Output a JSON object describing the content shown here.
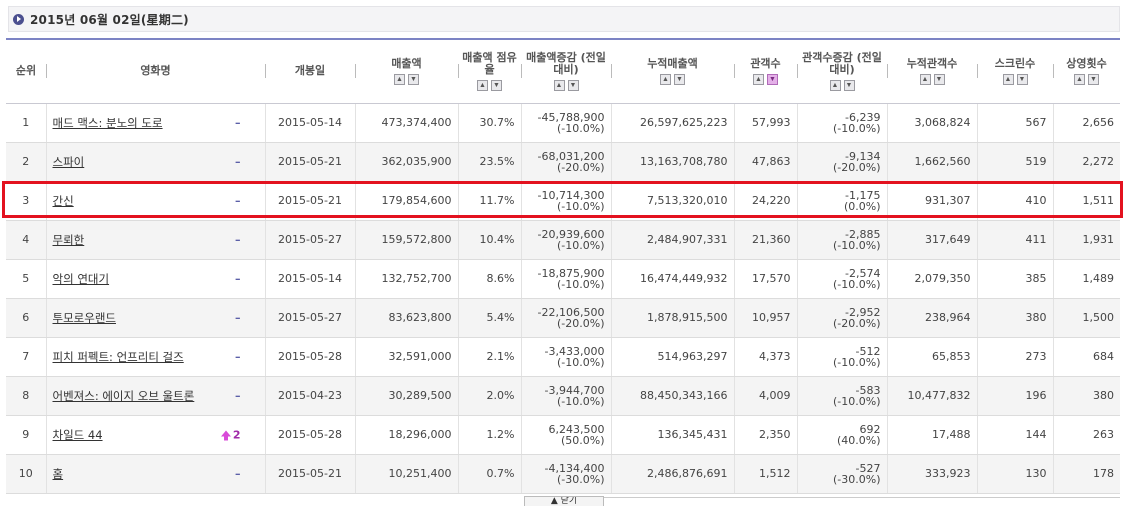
{
  "header": {
    "date": "2015년 06월 02일(星期二)"
  },
  "columns": [
    {
      "label": "순위",
      "sortable": false
    },
    {
      "label": "영화명",
      "sortable": false
    },
    {
      "label": "개봉일",
      "sortable": false
    },
    {
      "label": "매출액",
      "sortable": true
    },
    {
      "label": "매출액 점유율",
      "sortable": true
    },
    {
      "label": "매출액증감 (전일대비)",
      "sortable": true
    },
    {
      "label": "누적매출액",
      "sortable": true
    },
    {
      "label": "관객수",
      "sortable": true,
      "active_sort": "down"
    },
    {
      "label": "관객수증감 (전일대비)",
      "sortable": true
    },
    {
      "label": "누적관객수",
      "sortable": true
    },
    {
      "label": "스크린수",
      "sortable": true
    },
    {
      "label": "상영횟수",
      "sortable": true
    }
  ],
  "rows": [
    {
      "rank": "1",
      "title": "매드 맥스: 분노의 도로",
      "rank_change": "–",
      "rank_change_type": "same",
      "release": "2015-05-14",
      "sales": "473,374,400",
      "share": "30.7%",
      "sales_diff": "-45,788,900",
      "sales_diff_pct": "(-10.0%)",
      "cum_sales": "26,597,625,223",
      "audience": "57,993",
      "aud_diff": "-6,239",
      "aud_diff_pct": "(-10.0%)",
      "cum_audience": "3,068,824",
      "screens": "567",
      "shows": "2,656"
    },
    {
      "rank": "2",
      "title": "스파이",
      "rank_change": "–",
      "rank_change_type": "same",
      "release": "2015-05-21",
      "sales": "362,035,900",
      "share": "23.5%",
      "sales_diff": "-68,031,200",
      "sales_diff_pct": "(-20.0%)",
      "cum_sales": "13,163,708,780",
      "audience": "47,863",
      "aud_diff": "-9,134",
      "aud_diff_pct": "(-20.0%)",
      "cum_audience": "1,662,560",
      "screens": "519",
      "shows": "2,272"
    },
    {
      "rank": "3",
      "title": "간신",
      "rank_change": "–",
      "rank_change_type": "same",
      "release": "2015-05-21",
      "sales": "179,854,600",
      "share": "11.7%",
      "sales_diff": "-10,714,300",
      "sales_diff_pct": "(-10.0%)",
      "cum_sales": "7,513,320,010",
      "audience": "24,220",
      "aud_diff": "-1,175",
      "aud_diff_pct": "(0.0%)",
      "cum_audience": "931,307",
      "screens": "410",
      "shows": "1,511"
    },
    {
      "rank": "4",
      "title": "무뢰한",
      "rank_change": "–",
      "rank_change_type": "same",
      "release": "2015-05-27",
      "sales": "159,572,800",
      "share": "10.4%",
      "sales_diff": "-20,939,600",
      "sales_diff_pct": "(-10.0%)",
      "cum_sales": "2,484,907,331",
      "audience": "21,360",
      "aud_diff": "-2,885",
      "aud_diff_pct": "(-10.0%)",
      "cum_audience": "317,649",
      "screens": "411",
      "shows": "1,931"
    },
    {
      "rank": "5",
      "title": "악의 연대기",
      "rank_change": "–",
      "rank_change_type": "same",
      "release": "2015-05-14",
      "sales": "132,752,700",
      "share": "8.6%",
      "sales_diff": "-18,875,900",
      "sales_diff_pct": "(-10.0%)",
      "cum_sales": "16,474,449,932",
      "audience": "17,570",
      "aud_diff": "-2,574",
      "aud_diff_pct": "(-10.0%)",
      "cum_audience": "2,079,350",
      "screens": "385",
      "shows": "1,489"
    },
    {
      "rank": "6",
      "title": "투모로우랜드",
      "rank_change": "–",
      "rank_change_type": "same",
      "release": "2015-05-27",
      "sales": "83,623,800",
      "share": "5.4%",
      "sales_diff": "-22,106,500",
      "sales_diff_pct": "(-20.0%)",
      "cum_sales": "1,878,915,500",
      "audience": "10,957",
      "aud_diff": "-2,952",
      "aud_diff_pct": "(-20.0%)",
      "cum_audience": "238,964",
      "screens": "380",
      "shows": "1,500"
    },
    {
      "rank": "7",
      "title": "피치 퍼펙트: 언프리티 걸즈",
      "rank_change": "–",
      "rank_change_type": "same",
      "release": "2015-05-28",
      "sales": "32,591,000",
      "share": "2.1%",
      "sales_diff": "-3,433,000",
      "sales_diff_pct": "(-10.0%)",
      "cum_sales": "514,963,297",
      "audience": "4,373",
      "aud_diff": "-512",
      "aud_diff_pct": "(-10.0%)",
      "cum_audience": "65,853",
      "screens": "273",
      "shows": "684"
    },
    {
      "rank": "8",
      "title": "어벤져스: 에이지 오브 울트론",
      "rank_change": "–",
      "rank_change_type": "same",
      "release": "2015-04-23",
      "sales": "30,289,500",
      "share": "2.0%",
      "sales_diff": "-3,944,700",
      "sales_diff_pct": "(-10.0%)",
      "cum_sales": "88,450,343,166",
      "audience": "4,009",
      "aud_diff": "-583",
      "aud_diff_pct": "(-10.0%)",
      "cum_audience": "10,477,832",
      "screens": "196",
      "shows": "380"
    },
    {
      "rank": "9",
      "title": "차일드 44",
      "rank_change": "2",
      "rank_change_type": "up",
      "release": "2015-05-28",
      "sales": "18,296,000",
      "share": "1.2%",
      "sales_diff": "6,243,500",
      "sales_diff_pct": "(50.0%)",
      "cum_sales": "136,345,431",
      "audience": "2,350",
      "aud_diff": "692",
      "aud_diff_pct": "(40.0%)",
      "cum_audience": "17,488",
      "screens": "144",
      "shows": "263"
    },
    {
      "rank": "10",
      "title": "홈",
      "rank_change": "–",
      "rank_change_type": "same",
      "release": "2015-05-21",
      "sales": "10,251,400",
      "share": "0.7%",
      "sales_diff": "-4,134,400",
      "sales_diff_pct": "(-30.0%)",
      "cum_sales": "2,486,876,691",
      "audience": "1,512",
      "aud_diff": "-527",
      "aud_diff_pct": "(-30.0%)",
      "cum_audience": "333,923",
      "screens": "130",
      "shows": "178"
    }
  ],
  "highlight": {
    "row_rank": "3",
    "color": "#e3121f"
  },
  "footer": {
    "tab_label": "▲ 닫기"
  },
  "colors": {
    "header_rule": "#7c83c4",
    "same_marker": "#5b5fa8",
    "up_marker": "#d94bd9"
  }
}
